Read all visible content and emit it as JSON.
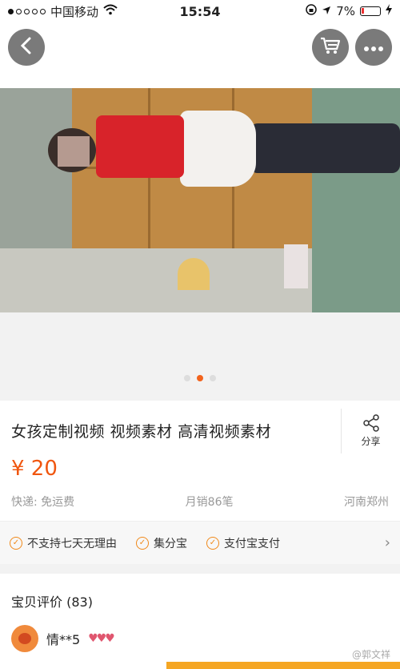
{
  "status_bar": {
    "carrier": "中国移动",
    "time": "15:54",
    "battery": "7%"
  },
  "product": {
    "title": "女孩定制视频  视频素材 高清视频素材",
    "price": "¥ 20",
    "shipping": "快递: 免运费",
    "monthly_sales": "月销86笔",
    "location": "河南郑州",
    "share_label": "分享"
  },
  "services": [
    {
      "label": "不支持七天无理由"
    },
    {
      "label": "集分宝"
    },
    {
      "label": "支付宝支付"
    }
  ],
  "reviews": {
    "title": "宝贝评价 (83)",
    "first_reviewer": "情**5"
  },
  "watermark": "@郭文祥",
  "colors": {
    "accent": "#f2631d",
    "price": "#f0560f",
    "check": "#f0891a"
  }
}
